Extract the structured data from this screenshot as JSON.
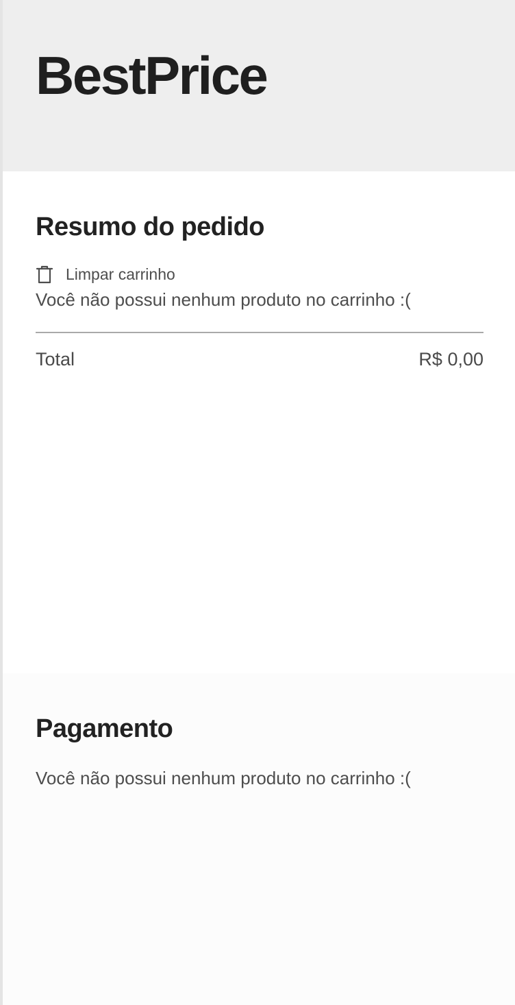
{
  "header": {
    "brand": "BestPrice"
  },
  "summary": {
    "title": "Resumo do pedido",
    "clear_cart_label": "Limpar carrinho",
    "empty_message": "Você não possui nenhum produto no carrinho :(",
    "total_label": "Total",
    "total_value": "R$ 0,00",
    "clear_icon": "trash-icon"
  },
  "payment": {
    "title": "Pagamento",
    "empty_message": "Você não possui nenhum produto no carrinho :("
  },
  "colors": {
    "header_bg": "#eeeeee",
    "text_dark": "#222222",
    "text_muted": "#4d4d4d",
    "divider": "#a9a9a9",
    "payment_bg": "#fcfcfc"
  }
}
